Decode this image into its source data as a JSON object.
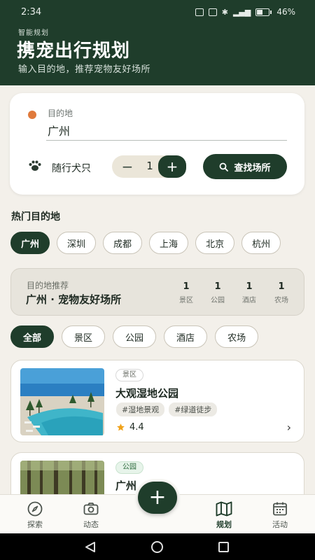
{
  "status_bar": {
    "time": "2:34",
    "battery": "46%"
  },
  "header": {
    "eyebrow": "智能规划",
    "title": "携宠出行规划",
    "subtitle": "输入目的地，推荐宠物友好场所"
  },
  "search_card": {
    "destination_label": "目的地",
    "destination_value": "广州",
    "pets_label": "随行犬只",
    "pet_count": "1",
    "minus_label": "−",
    "plus_label": "+",
    "find_button": "查找场所"
  },
  "hot_destinations": {
    "title": "热门目的地",
    "cities": [
      "广州",
      "深圳",
      "成都",
      "上海",
      "北京",
      "杭州"
    ],
    "selected": "广州"
  },
  "recommend": {
    "label": "目的地推荐",
    "title": "广州 · 宠物友好场所",
    "stats": [
      {
        "num": "1",
        "label": "景区"
      },
      {
        "num": "1",
        "label": "公园"
      },
      {
        "num": "1",
        "label": "酒店"
      },
      {
        "num": "1",
        "label": "农场"
      }
    ]
  },
  "filters": [
    "全部",
    "景区",
    "公园",
    "酒店",
    "农场"
  ],
  "places": [
    {
      "badge": "景区",
      "name": "大观湿地公园",
      "tags": [
        "#湿地景观",
        "#绿道徒步"
      ],
      "rating": "4.4",
      "chevron": "›"
    },
    {
      "badge": "公园",
      "name": "广州",
      "tags": [],
      "rating": "",
      "chevron": ""
    }
  ],
  "bottom_nav": {
    "items": [
      {
        "label": "探索",
        "icon": "compass-icon"
      },
      {
        "label": "动态",
        "icon": "camera-icon"
      },
      {
        "label": "规划",
        "icon": "map-icon"
      },
      {
        "label": "活动",
        "icon": "calendar-icon"
      }
    ],
    "active": "规划",
    "fab": "+"
  },
  "colors": {
    "primary": "#1f3d2b",
    "background": "#f3f0ea",
    "accent_orange": "#e07a3c",
    "star": "#f0a21a"
  }
}
